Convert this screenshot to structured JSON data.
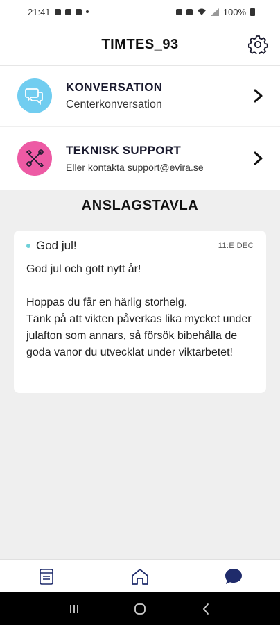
{
  "status_bar": {
    "time": "21:41",
    "battery": "100%"
  },
  "header": {
    "title": "TIMTES_93",
    "settings_icon": "gear-icon"
  },
  "menu": [
    {
      "title": "KONVERSATION",
      "subtitle": "Centerkonversation",
      "icon": "chat-bubbles-icon",
      "color": "#71cdf0"
    },
    {
      "title": "TEKNISK SUPPORT",
      "subtitle": "Eller kontakta support@evira.se",
      "icon": "tools-icon",
      "color": "#ed5aa4"
    }
  ],
  "board": {
    "title": "ANSLAGSTAVLA",
    "posts": [
      {
        "title": "God jul!",
        "date": "11:E DEC",
        "body": "God jul och gott nytt år!\n\nHoppas du får en härlig storhelg.\nTänk på att vikten påverkas lika mycket under julafton som annars, så försök bibehålla de goda vanor du utvecklat under viktarbetet!"
      }
    ]
  },
  "tabbar": {
    "tabs": [
      "diary-icon",
      "home-icon",
      "chat-icon"
    ],
    "active_color": "#1f2b6b"
  },
  "navbar": {
    "buttons": [
      "recents-icon",
      "home-circle-icon",
      "back-icon"
    ]
  }
}
